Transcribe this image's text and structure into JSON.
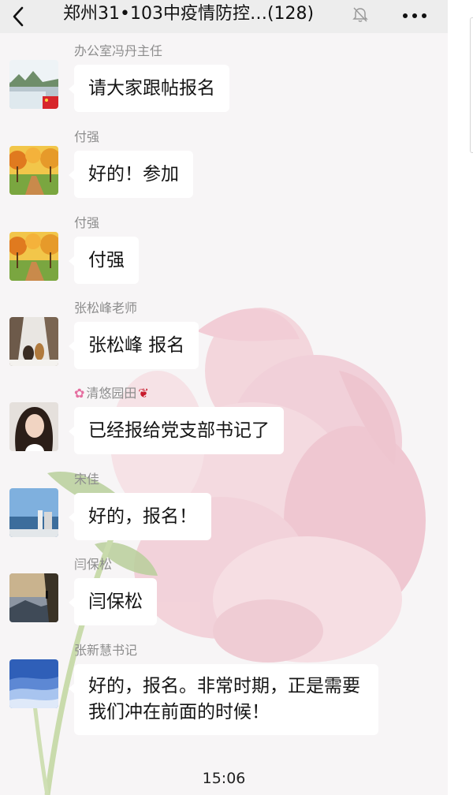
{
  "header": {
    "title": "郑州31•103中疫情防控…(128)",
    "back_icon": "chevron-left-icon",
    "mute_icon": "bell-off-icon",
    "more_icon": "more-dots-icon"
  },
  "messages": [
    {
      "sender": "办公室冯丹主任",
      "text": "请大家跟帖报名",
      "avatar": "lake-landscape-avatar"
    },
    {
      "sender": "付强",
      "text": "好的！参加",
      "avatar": "autumn-trees-avatar"
    },
    {
      "sender": "付强",
      "text": "付强",
      "avatar": "autumn-trees-avatar"
    },
    {
      "sender": "张松峰老师",
      "text": "张松峰  报名",
      "avatar": "snow-dogs-avatar"
    },
    {
      "sender": "清悠园田",
      "text": "已经报给党支部书记了",
      "avatar": "woman-portrait-avatar"
    },
    {
      "sender": "宋佳",
      "text": "好的，报名！",
      "avatar": "harbor-avatar"
    },
    {
      "sender": "闫保松",
      "text": "闫保松",
      "avatar": "cliff-climber-avatar"
    },
    {
      "sender": "张新慧书记",
      "text": "好的，报名。非常时期，正是需要我们冲在前面的时候！",
      "avatar": "blue-dunes-avatar"
    }
  ],
  "timestamp": "15:06",
  "colors": {
    "header_bg": "#ededed",
    "bubble_bg": "#ffffff",
    "sender_text": "#8d8d8d",
    "message_text": "#151515"
  }
}
